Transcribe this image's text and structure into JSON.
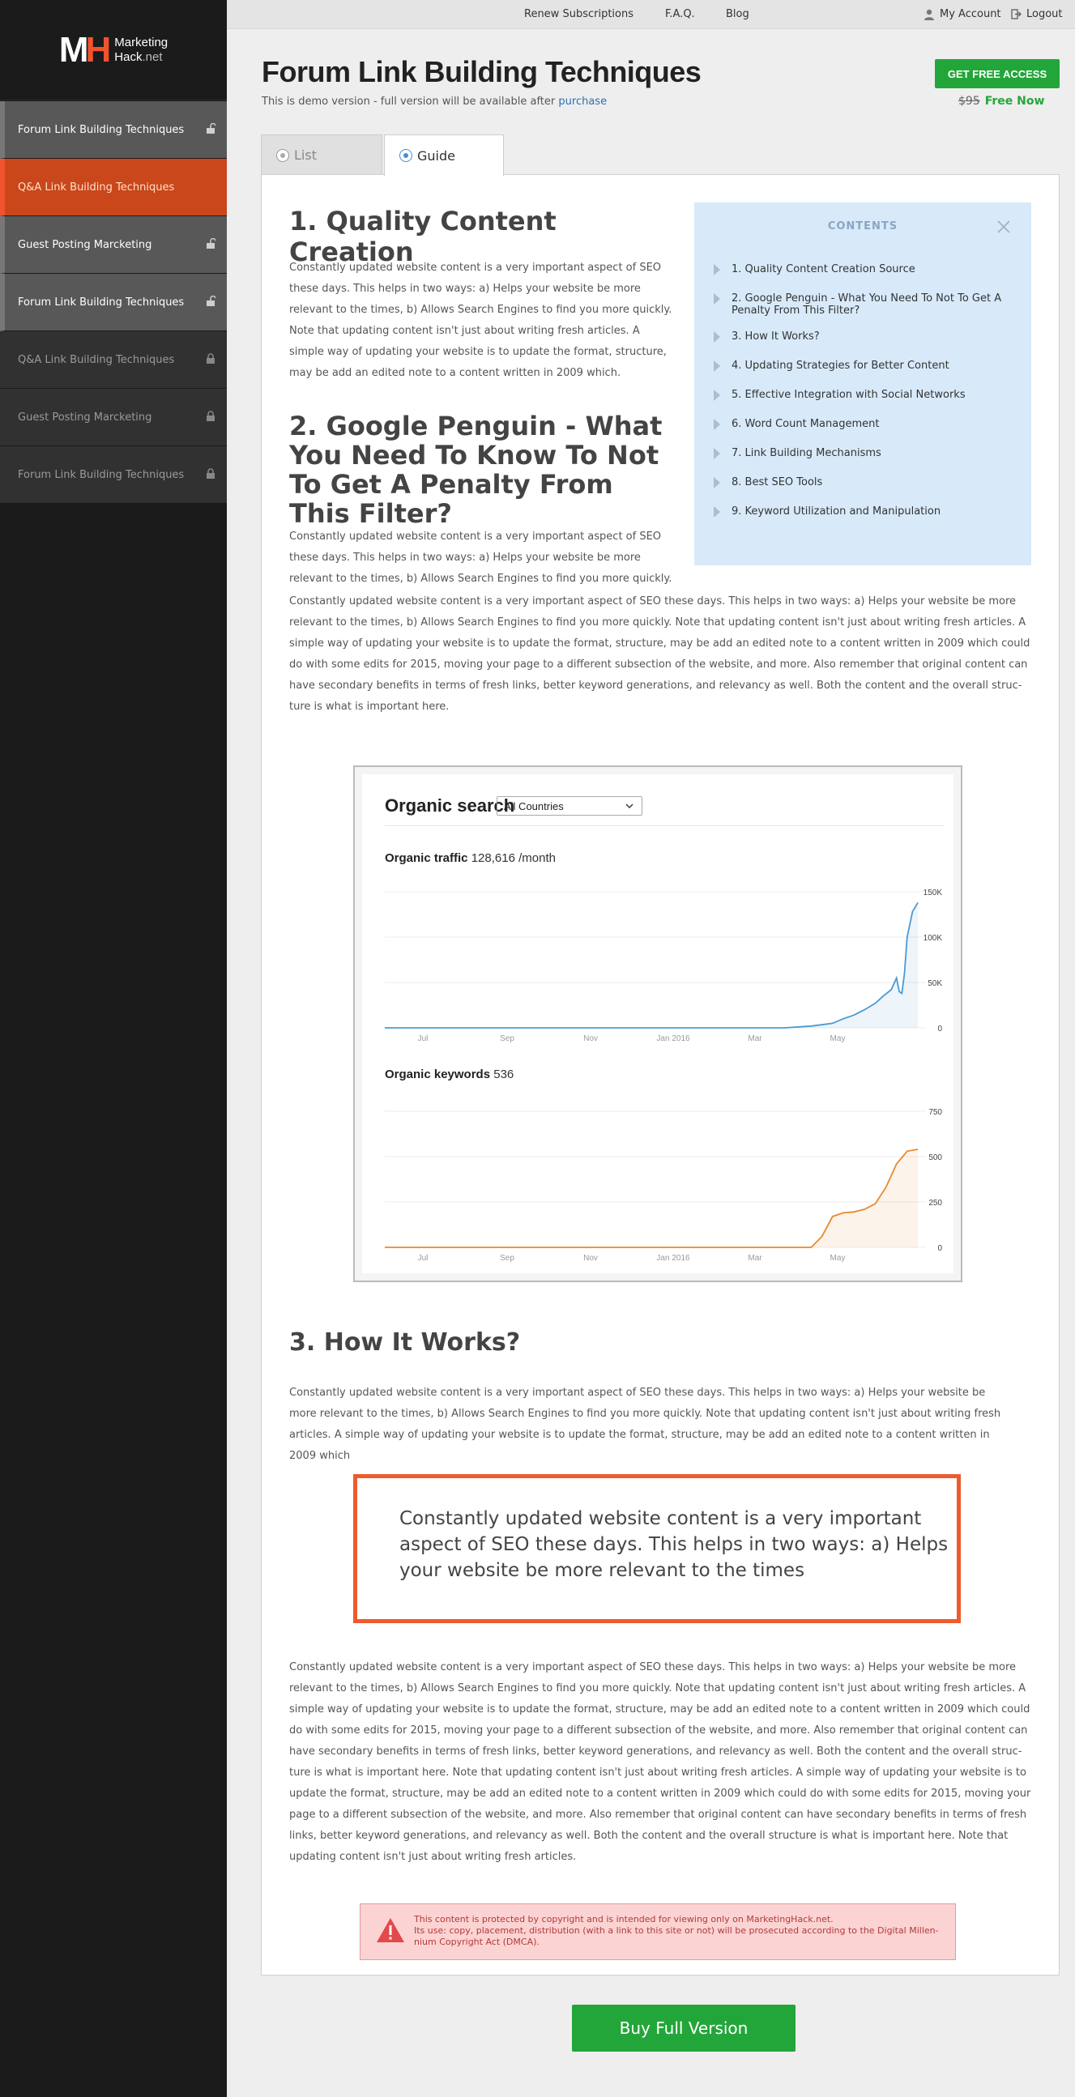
{
  "brand": {
    "line1": "Marketing",
    "line2": "Hack",
    "line2_suffix": ".net",
    "mark_left": "M",
    "mark_right": "H"
  },
  "sidebar": {
    "items": [
      {
        "label": "Forum Link Building Techniques",
        "state": "unlocked"
      },
      {
        "label": "Q&A Link Building Techniques",
        "state": "active"
      },
      {
        "label": "Guest Posting Marcketing",
        "state": "unlocked"
      },
      {
        "label": "Forum Link Building Techniques",
        "state": "unlocked"
      },
      {
        "label": "Q&A Link Building Techniques",
        "state": "locked"
      },
      {
        "label": "Guest Posting Marcketing",
        "state": "locked"
      },
      {
        "label": "Forum Link Building Techniques",
        "state": "locked"
      }
    ]
  },
  "topbar": {
    "renew": "Renew Subscriptions",
    "faq": "F.A.Q.",
    "blog": "Blog",
    "account": "My Account",
    "logout": "Logout"
  },
  "header": {
    "title": "Forum Link Building Techniques",
    "demo_note": "This is demo version - full version will be available after",
    "demo_link": "purchase",
    "cta": "GET FREE ACCESS",
    "old_price": "$95",
    "free_now": "Free Now"
  },
  "tabs": {
    "list": "List",
    "guide": "Guide",
    "selected": "Guide"
  },
  "sections": {
    "s1_title": "1. Quality Content Creation",
    "s1_text": "Constantly updated website content is a very important aspect of SEO these days. This helps in two ways: a) Helps your website be more relevant to the times, b) Allows Search Engines to find you more quickly. Note that updating content isn't just about writing fresh articles. A simple way of updating your website is to update the format, structure, may be add an edited note to a content written in 2009 which.",
    "s2_title": "2. Google Penguin - What You Need To Know To Not To Get A Penalty From This Filter?",
    "s2_text_a": "Constantly updated website content is a very important aspect of SEO these days. This helps in two ways: a) Helps your website be more relevant to the times, b) Allows Search Engines to find you more quickly.",
    "s2_text_b": "Constantly updated website content is a very important aspect of SEO these days. This helps in two ways: a) Helps your website be more relevant to the times, b) Allows Search Engines to find you more quickly. Note that updating content isn't just about writing fresh articles. A simple way of updating your website is to update the format, structure, may be add an edited note to a content written in 2009 which could do with some edits for 2015, moving your page to a different subsection of the website, and more. Also remember that original content can have secondary benefits in terms of fresh links, better keyword generations, and relevancy as well. Both the content and the overall struc-ture is what is important here.",
    "s3_title": "3. How It Works?",
    "s3_text": "Constantly updated website content is a very important aspect of SEO these days. This helps in two ways: a) Helps your website be more relevant to the times, b) Allows Search Engines to find you more quickly. Note that updating content isn't just about writing fresh articles. A simple way of updating your website is to update the format, structure, may be add an edited note to a content written in 2009 which",
    "quote": "Constantly updated website content is a very important aspect of SEO these days. This helps in two ways: a) Helps your website be more relevant to the times",
    "s3_text_long": "Constantly updated website content is a very important aspect of SEO these days. This helps in two ways: a) Helps your website be more relevant to the times, b) Allows Search Engines to find you more quickly. Note that updating content isn't just about writing fresh articles. A simple way of updating your website is to update the format, structure, may be add an edited note to a content written in 2009 which could do with some edits for 2015, moving your page to a different subsection of the website, and more. Also remember that original content can have secondary benefits in terms of fresh links, better keyword generations, and relevancy as well. Both the content and the overall struc-ture is what is important here. Note that updating content isn't just about writing fresh articles. A simple way of updating your website is to update the format, structure, may be add an edited note to a content written in 2009 which could do with some edits for 2015, moving your page to a different subsection of the website, and more. Also remember that original content can have secondary benefits in terms of fresh links, better keyword generations, and relevancy as well. Both the content and the overall structure is what is important here. Note that updating content isn't just about writing fresh articles."
  },
  "toc": {
    "title": "CONTENTS",
    "items": [
      "1. Quality Content Creation Source",
      "2. Google Penguin - What You Need To Not To Get A Penalty From This Filter?",
      "3. How It Works?",
      "4. Updating Strategies for Better Content",
      "5. Effective Integration with Social Networks",
      "6. Word Count Management",
      "7. Link Building Mechanisms",
      "8. Best SEO Tools",
      "9. Keyword Utilization and Manipulation"
    ]
  },
  "figure": {
    "title": "Organic search",
    "country": "All Countries",
    "traffic_label": "Organic traffic",
    "traffic_value": "128,616 /month",
    "keywords_label": "Organic keywords",
    "keywords_value": "536"
  },
  "chart_data": [
    {
      "type": "area",
      "title": "Organic traffic",
      "x_ticks": [
        "Jul",
        "Sep",
        "Nov",
        "Jan 2016",
        "Mar",
        "May"
      ],
      "y_ticks": [
        "0",
        "50K",
        "100K",
        "150K"
      ],
      "ylim": [
        0,
        150000
      ],
      "color": "#4a9ad4",
      "series": [
        {
          "x": [
            0,
            0.4,
            0.75,
            0.8,
            0.84,
            0.86,
            0.88,
            0.9,
            0.92,
            0.935,
            0.95,
            0.96,
            0.965,
            0.97,
            0.975,
            0.98,
            0.99,
            1.0
          ],
          "values": [
            0,
            0,
            0,
            2000,
            5000,
            10000,
            14000,
            20000,
            27000,
            35000,
            42000,
            55000,
            40000,
            38000,
            60000,
            100000,
            128000,
            138000
          ]
        }
      ]
    },
    {
      "type": "area",
      "title": "Organic keywords",
      "x_ticks": [
        "Jul",
        "Sep",
        "Nov",
        "Jan 2016",
        "Mar",
        "May"
      ],
      "y_ticks": [
        "0",
        "250",
        "500",
        "750"
      ],
      "ylim": [
        0,
        750
      ],
      "color": "#e68a2e",
      "series": [
        {
          "x": [
            0,
            0.5,
            0.8,
            0.82,
            0.84,
            0.86,
            0.88,
            0.9,
            0.92,
            0.94,
            0.96,
            0.98,
            1.0
          ],
          "values": [
            0,
            0,
            0,
            60,
            170,
            190,
            195,
            210,
            240,
            330,
            460,
            530,
            540
          ]
        }
      ]
    }
  ],
  "notice": {
    "line1": "This content is protected by copyright and is intended for viewing only on MarketingHack.net.",
    "line2": "Its use: copy, placement, distribution (with a link to this site or not) will be prosecuted according to the Digital Millen-nium Copyright Act (DMCA)."
  },
  "buy_button": "Buy Full Version",
  "colors": {
    "accent": "#ef5a2d",
    "green": "#23a639",
    "sidebar_bg": "#1b1b1b",
    "toc_bg": "#d8eafa"
  }
}
